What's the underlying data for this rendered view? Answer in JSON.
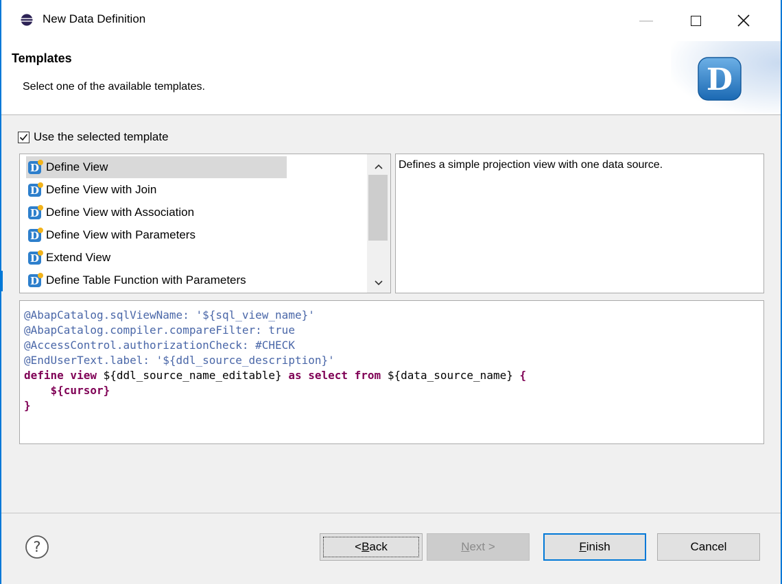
{
  "window": {
    "title": "New Data Definition"
  },
  "banner": {
    "title": "Templates",
    "description": "Select one of the available templates.",
    "logo_letter": "D"
  },
  "checkbox": {
    "label": "Use the selected template",
    "checked": true
  },
  "templates": {
    "selected_index": 0,
    "items": [
      {
        "label": "Define View"
      },
      {
        "label": "Define View with Join"
      },
      {
        "label": "Define View with Association"
      },
      {
        "label": "Define View with Parameters"
      },
      {
        "label": "Extend View"
      },
      {
        "label": "Define Table Function with Parameters"
      }
    ]
  },
  "description": {
    "text": "Defines a simple projection view with one data source."
  },
  "code": {
    "lines": [
      "@AbapCatalog.sqlViewName: '${sql_view_name}'",
      "@AbapCatalog.compiler.compareFilter: true",
      "@AccessControl.authorizationCheck: #CHECK",
      "@EndUserText.label: '${ddl_source_description}'",
      "define view ${ddl_source_name_editable} as select from ${data_source_name} {",
      "    ${cursor}",
      "}"
    ],
    "line4_parts": {
      "kw_define_view": "define view",
      "name": " ${ddl_source_name_editable} ",
      "kw_as_select_from": "as select from",
      "source": " ${data_source_name} ",
      "brace": "{"
    },
    "line5": "    ${cursor}",
    "line6": "}"
  },
  "buttons": {
    "help_glyph": "?",
    "back": {
      "pre": "< ",
      "mnemonic": "B",
      "post": "ack"
    },
    "next": {
      "mnemonic": "N",
      "post": "ext >"
    },
    "finish": {
      "mnemonic": "F",
      "post": "inish"
    },
    "cancel": "Cancel"
  },
  "colors": {
    "accent": "#0078d7",
    "annotation": "#4a67a8",
    "keyword": "#7f0055",
    "selection": "#d9d9d9"
  }
}
